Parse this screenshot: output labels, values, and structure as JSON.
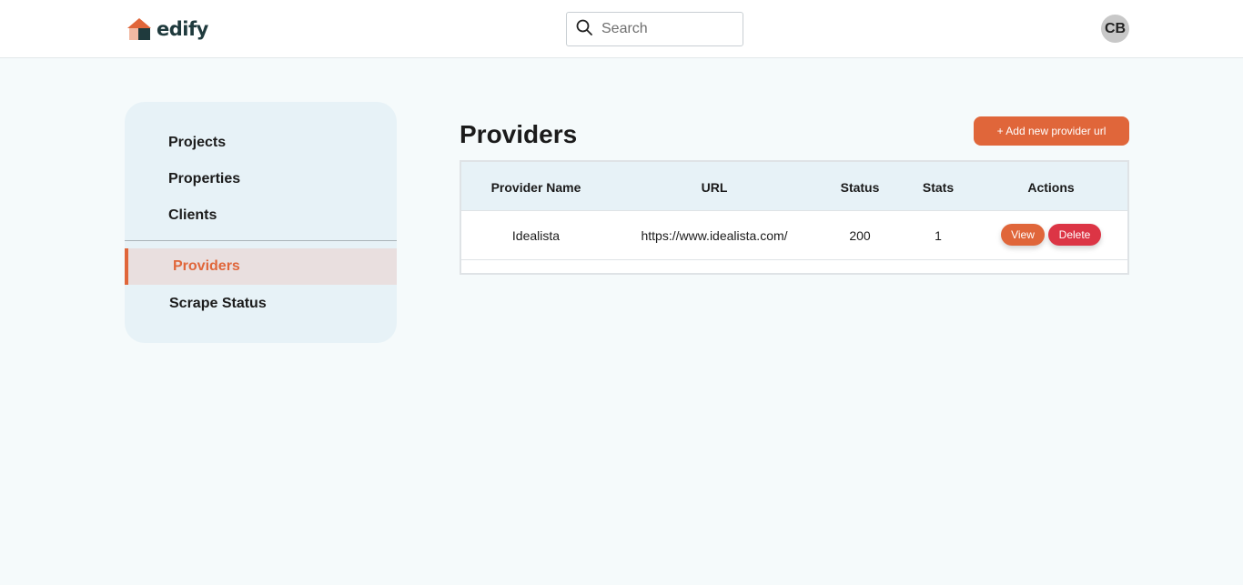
{
  "header": {
    "logo_text": "edify",
    "search_placeholder": "Search",
    "avatar_initials": "CB"
  },
  "sidebar": {
    "items": [
      {
        "label": "Projects"
      },
      {
        "label": "Properties"
      },
      {
        "label": "Clients"
      },
      {
        "label": "Providers",
        "active": true
      },
      {
        "label": "Scrape Status"
      }
    ]
  },
  "main": {
    "title": "Providers",
    "add_button_label": "+ Add new provider url",
    "table": {
      "columns": [
        "Provider Name",
        "URL",
        "Status",
        "Stats",
        "Actions"
      ],
      "rows": [
        {
          "provider_name": "Idealista",
          "url": "https://www.idealista.com/",
          "status": "200",
          "stats": "1",
          "view_label": "View",
          "delete_label": "Delete"
        }
      ]
    }
  },
  "colors": {
    "accent": "#e0663a",
    "danger": "#dc3545",
    "sidebar_bg": "#e7f2f7",
    "page_bg": "#f5fafb"
  },
  "icons": [
    "house-logo-icon",
    "search-icon"
  ]
}
